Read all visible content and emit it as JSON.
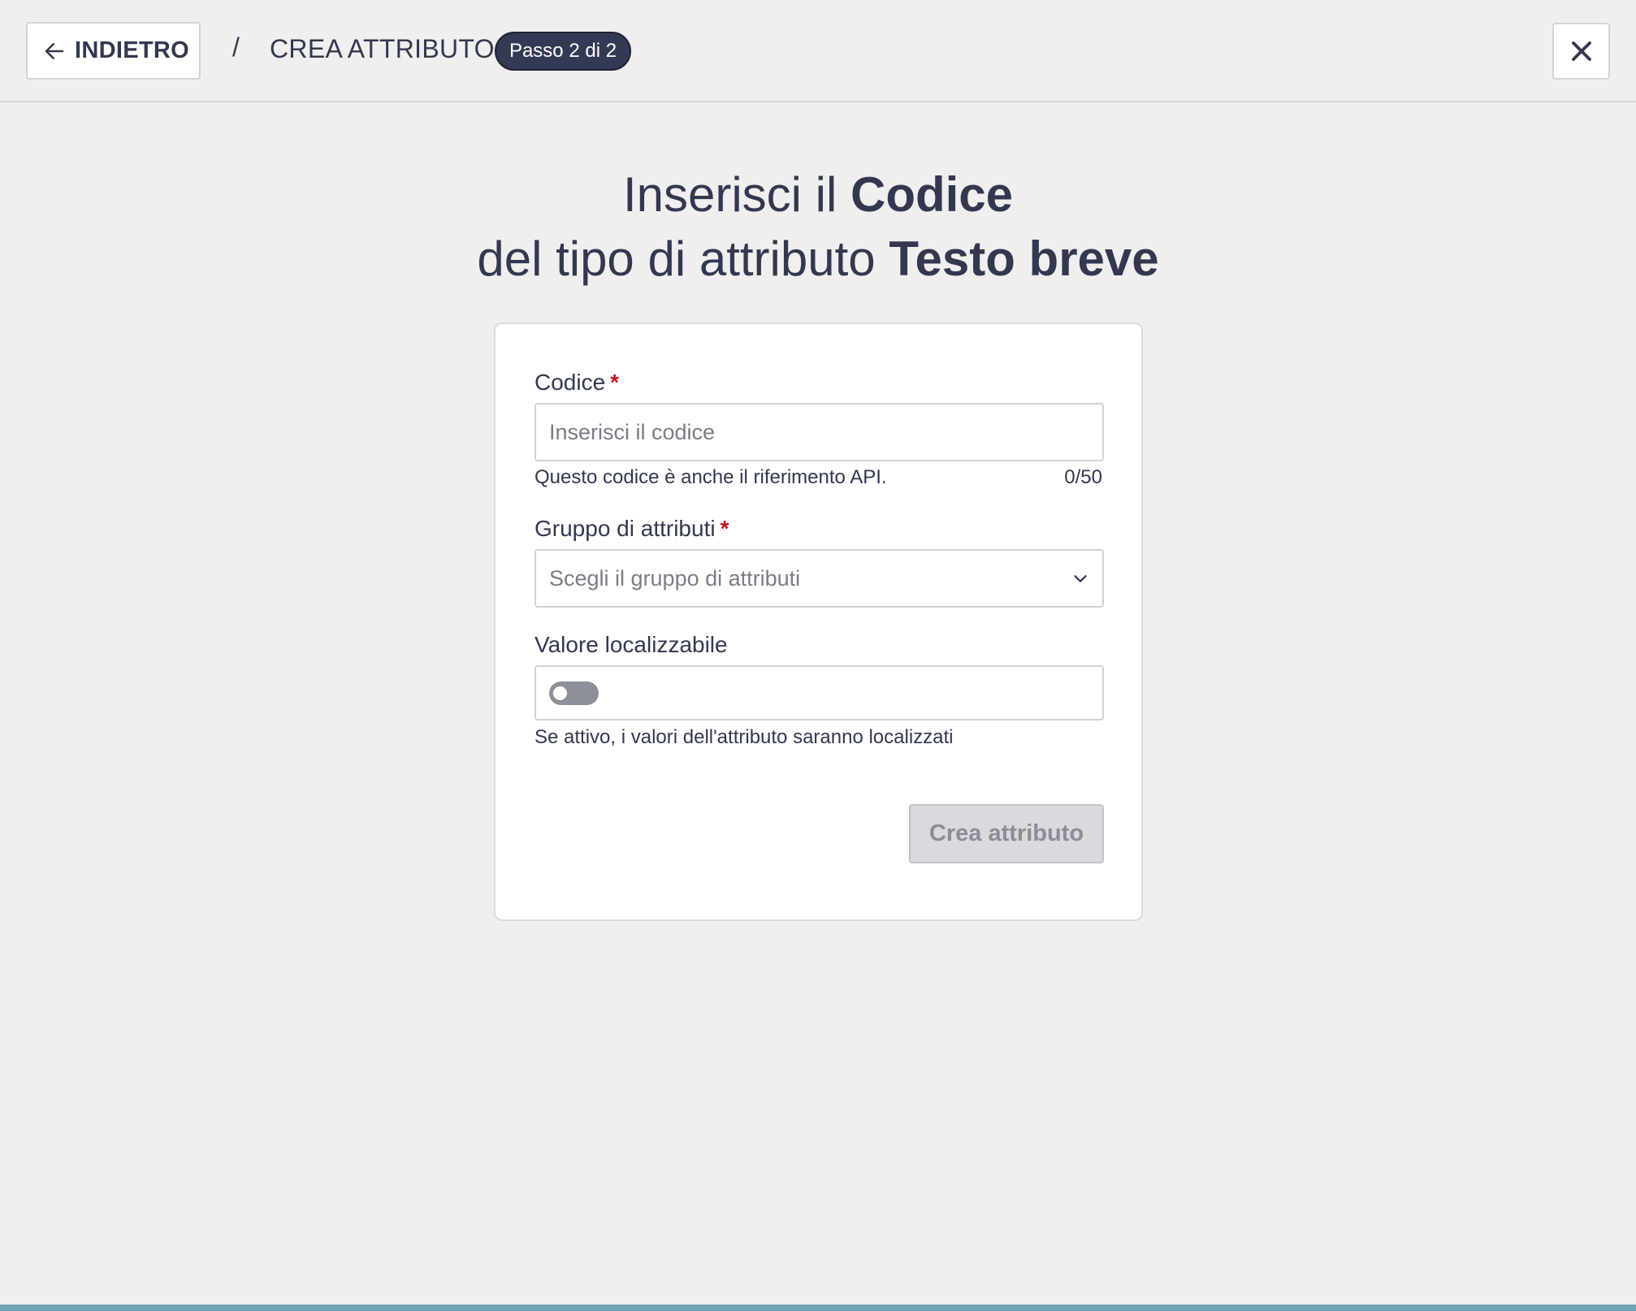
{
  "header": {
    "back_label": "INDIETRO",
    "separator": "/",
    "title": "CREA ATTRIBUTO",
    "step_badge": "Passo 2 di 2"
  },
  "heading": {
    "line1_prefix": "Inserisci il ",
    "line1_bold": "Codice",
    "line2_prefix": "del tipo di attributo ",
    "line2_bold": "Testo breve"
  },
  "form": {
    "code": {
      "label": "Codice",
      "required_mark": "*",
      "placeholder": "Inserisci il codice",
      "value": "",
      "helper": "Questo codice è anche il riferimento API.",
      "counter": "0/50"
    },
    "group": {
      "label": "Gruppo di attributi",
      "required_mark": "*",
      "placeholder": "Scegli il gruppo di attributi"
    },
    "localizable": {
      "label": "Valore localizzabile",
      "enabled": false,
      "helper": "Se attivo, i valori dell'attributo saranno localizzati"
    },
    "submit_label": "Crea attributo"
  },
  "colors": {
    "text": "#333850",
    "badge_bg": "#343a55",
    "required": "#c2141f",
    "toggle_off": "#8d8f99",
    "button_disabled_bg": "#d9d9de"
  },
  "icons": {
    "back": "arrow-left-icon",
    "close": "close-icon",
    "select": "chevron-down-icon"
  }
}
